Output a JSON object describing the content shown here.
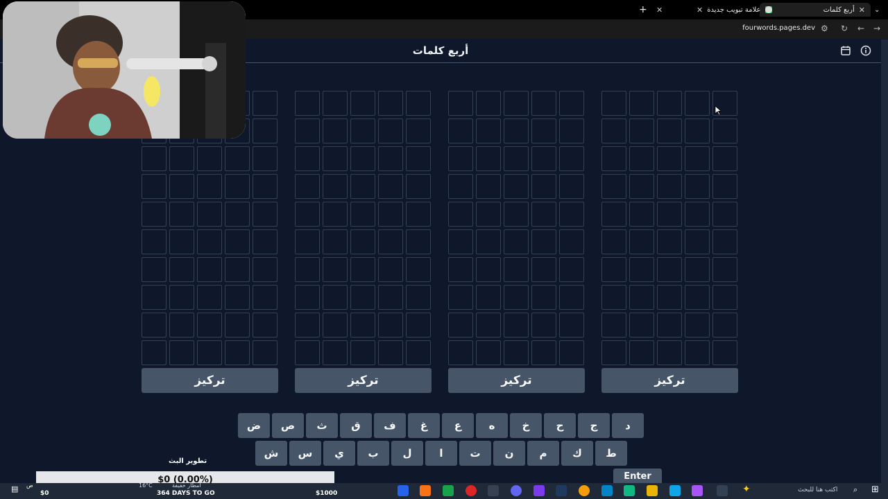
{
  "browser": {
    "tabs": [
      {
        "title": "أربع كلمات"
      },
      {
        "title": "علامة تبويب جديدة"
      }
    ],
    "url": "fourwords.pages.dev"
  },
  "page": {
    "title": "أربع كلمات",
    "boards": [
      {
        "focus_label": "تركيز"
      },
      {
        "focus_label": "تركيز"
      },
      {
        "focus_label": "تركيز"
      },
      {
        "focus_label": "تركيز"
      }
    ]
  },
  "keyboard": {
    "row1": [
      "د",
      "ج",
      "ح",
      "خ",
      "ه",
      "ع",
      "غ",
      "ف",
      "ق",
      "ث",
      "ص",
      "ض"
    ],
    "row2": [
      "ط",
      "ك",
      "م",
      "ن",
      "ت",
      "ا",
      "ل",
      "ب",
      "ي",
      "س",
      "ش"
    ],
    "enter_label": "Enter"
  },
  "stream_overlay": {
    "label": "تطوير البث",
    "amount": "$0 (0.00%)",
    "goal_start": "$0",
    "days_to_go": "364 DAYS TO GO",
    "goal_end": "$1000"
  },
  "taskbar": {
    "search_placeholder": "اكتب هنا للبحث",
    "weather": "16°C",
    "weather_desc": "أمطار خفيفة",
    "clock_period": "ص"
  }
}
